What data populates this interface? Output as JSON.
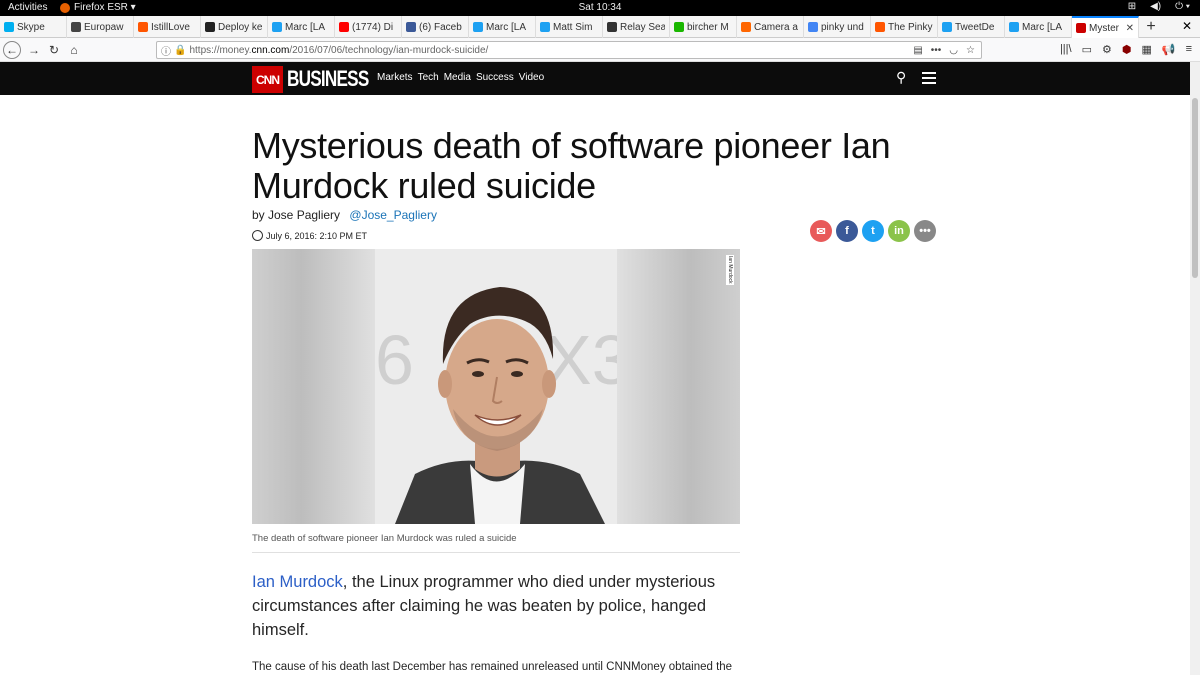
{
  "gnome": {
    "activities": "Activities",
    "app_menu": "Firefox ESR ▾",
    "clock": "Sat 10:34"
  },
  "tabs": [
    {
      "label": "Skype",
      "color": "#00aff0"
    },
    {
      "label": "Europaw",
      "color": "#444444"
    },
    {
      "label": "IstillLove",
      "color": "#ff5500"
    },
    {
      "label": "Deploy ke",
      "color": "#222222"
    },
    {
      "label": "Marc [LA",
      "color": "#1da1f2"
    },
    {
      "label": "(1774) Di",
      "color": "#ff0000"
    },
    {
      "label": "(6) Faceb",
      "color": "#3b5998"
    },
    {
      "label": "Marc [LA",
      "color": "#1da1f2"
    },
    {
      "label": "Matt Sim",
      "color": "#1da1f2"
    },
    {
      "label": "Relay Sea",
      "color": "#333333"
    },
    {
      "label": "bircher M",
      "color": "#1ab700"
    },
    {
      "label": "Camera a",
      "color": "#ff6600"
    },
    {
      "label": "pinky und",
      "color": "#4285f4"
    },
    {
      "label": "The Pinky",
      "color": "#ff5500"
    },
    {
      "label": "TweetDe",
      "color": "#1da1f2"
    },
    {
      "label": "Marc [LA",
      "color": "#1da1f2"
    },
    {
      "label": "Myster",
      "color": "#cc0000",
      "active": true
    }
  ],
  "urlbar": {
    "url_prefix": "https://money.",
    "url_domain": "cnn.com",
    "url_path": "/2016/07/06/technology/ian-murdock-suicide/"
  },
  "cnn": {
    "logo": "CNN",
    "brand": "BUSINESS",
    "nav": [
      "Markets",
      "Tech",
      "Media",
      "Success",
      "Video"
    ]
  },
  "article": {
    "headline_line1": "Mysterious death of software pioneer Ian",
    "headline_line2": "Murdock ruled suicide",
    "byline_prefix": "by Jose Pagliery",
    "byline_handle": "@Jose_Pagliery",
    "date": "July 6, 2016: 2:10 PM ET",
    "photo_credit": "Ian Murdock",
    "caption": "The death of software pioneer Ian Murdock was ruled a suicide",
    "lede_link": "Ian Murdock",
    "lede_rest": ", the Linux programmer who died under mysterious circumstances after claiming he was beaten by police, hanged himself.",
    "body_start": "The cause of his death last December has remained unreleased until CNNMoney obtained the"
  },
  "social": [
    {
      "name": "email",
      "glyph": "✉",
      "color": "#e85a5a"
    },
    {
      "name": "facebook",
      "glyph": "f",
      "color": "#3b5998"
    },
    {
      "name": "twitter",
      "glyph": "t",
      "color": "#1da1f2"
    },
    {
      "name": "linkedin",
      "glyph": "in",
      "color": "#8bc34a"
    },
    {
      "name": "more",
      "glyph": "•••",
      "color": "#888888"
    }
  ]
}
